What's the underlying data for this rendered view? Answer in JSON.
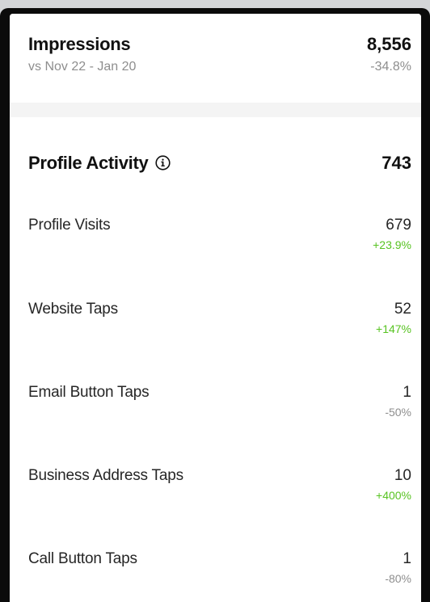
{
  "impressions": {
    "title": "Impressions",
    "subtitle": "vs Nov 22 - Jan 20",
    "value": "8,556",
    "change": "-34.8%"
  },
  "profile_activity": {
    "title": "Profile Activity",
    "info_icon": "info-circle-icon",
    "value": "743",
    "items": [
      {
        "label": "Profile Visits",
        "value": "679",
        "change": "+23.9%",
        "trend": "up"
      },
      {
        "label": "Website Taps",
        "value": "52",
        "change": "+147%",
        "trend": "up"
      },
      {
        "label": "Email Button Taps",
        "value": "1",
        "change": "-50%",
        "trend": "down"
      },
      {
        "label": "Business Address Taps",
        "value": "10",
        "change": "+400%",
        "trend": "up"
      },
      {
        "label": "Call Button Taps",
        "value": "1",
        "change": "-80%",
        "trend": "down"
      }
    ]
  },
  "colors": {
    "positive": "#58c322",
    "neutral": "#8e8e8e",
    "text": "#262626"
  }
}
